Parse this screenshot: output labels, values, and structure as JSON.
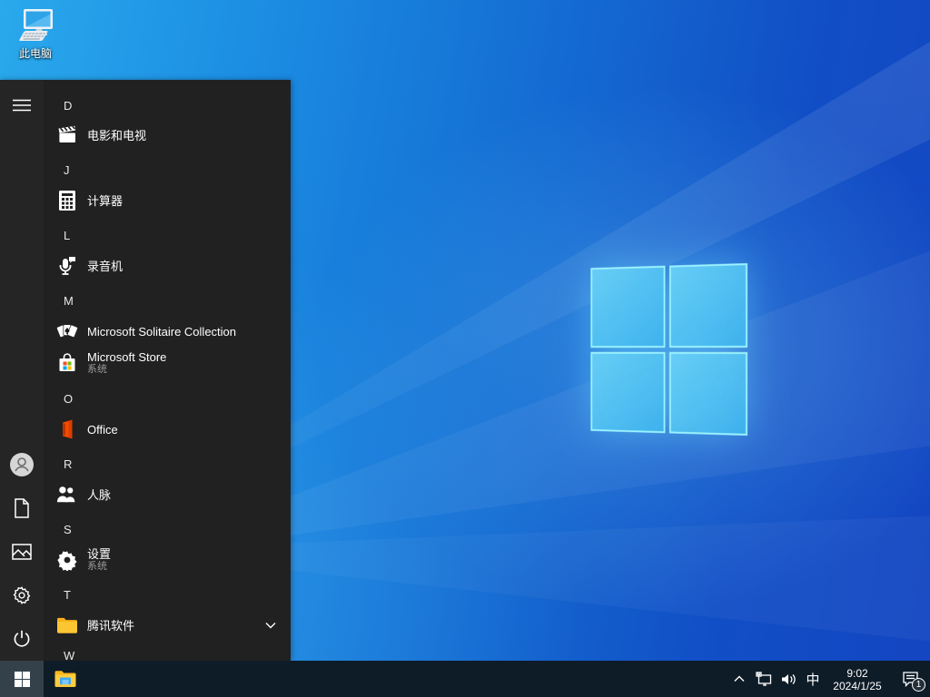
{
  "desktop": {
    "this_pc_label": "此电脑"
  },
  "start_menu": {
    "sections": [
      {
        "letter": "D",
        "apps": [
          {
            "label": "电影和电视",
            "icon": "movies-tv-icon"
          }
        ]
      },
      {
        "letter": "J",
        "apps": [
          {
            "label": "计算器",
            "icon": "calculator-icon"
          }
        ]
      },
      {
        "letter": "L",
        "apps": [
          {
            "label": "录音机",
            "icon": "voice-recorder-icon"
          }
        ]
      },
      {
        "letter": "M",
        "apps": [
          {
            "label": "Microsoft Solitaire Collection",
            "icon": "solitaire-icon"
          },
          {
            "label": "Microsoft Store",
            "sublabel": "系统",
            "icon": "store-icon"
          }
        ]
      },
      {
        "letter": "O",
        "apps": [
          {
            "label": "Office",
            "icon": "office-icon"
          }
        ]
      },
      {
        "letter": "R",
        "apps": [
          {
            "label": "人脉",
            "icon": "people-icon"
          }
        ]
      },
      {
        "letter": "S",
        "apps": [
          {
            "label": "设置",
            "sublabel": "系统",
            "icon": "settings-icon"
          }
        ]
      },
      {
        "letter": "T",
        "apps": [
          {
            "label": "腾讯软件",
            "icon": "folder-icon",
            "expandable": true
          }
        ]
      },
      {
        "letter": "W",
        "apps": []
      }
    ],
    "rail_icons": [
      "hamburger-icon",
      "user-avatar",
      "documents-icon",
      "pictures-icon",
      "settings-icon",
      "power-icon"
    ]
  },
  "taskbar": {
    "tray": {
      "ime": "中",
      "time": "9:02",
      "date": "2024/1/25",
      "notification_count": "1"
    }
  },
  "colors": {
    "wallpaper_light": "#2aa9ec",
    "wallpaper_dark": "#1445c2",
    "logo_pane": "#4fc0f0",
    "logo_edge": "#a0f5ff",
    "menu_bg": "#212121",
    "taskbar_bg": "#0e1c28",
    "folder_yellow": "#fbc02d",
    "office_orange": "#dc3e00",
    "store_red": "#f25022",
    "store_green": "#7fba00",
    "store_blue": "#00a4ef",
    "store_yellow": "#ffb900"
  }
}
